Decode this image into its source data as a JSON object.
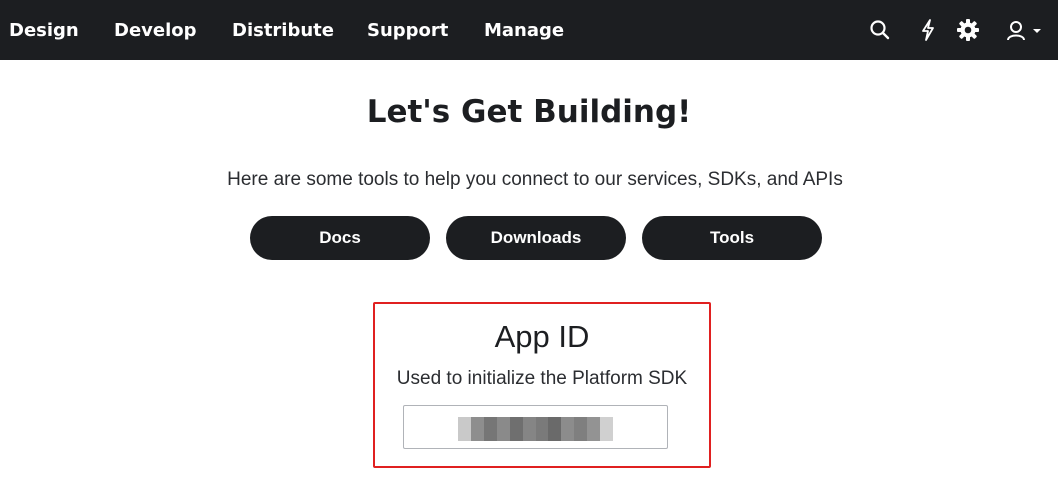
{
  "nav": {
    "items": [
      {
        "label": "Design"
      },
      {
        "label": "Develop"
      },
      {
        "label": "Distribute"
      },
      {
        "label": "Support"
      },
      {
        "label": "Manage"
      }
    ],
    "icons": [
      "search-icon",
      "bolt-icon",
      "gear-icon",
      "user-icon",
      "chevron-down-icon"
    ]
  },
  "hero": {
    "title": "Let's Get Building!",
    "subtitle": "Here are some tools to help you connect to our services, SDKs, and APIs"
  },
  "buttons": [
    {
      "label": "Docs"
    },
    {
      "label": "Downloads"
    },
    {
      "label": "Tools"
    }
  ],
  "app_id": {
    "title": "App ID",
    "description": "Used to initialize the Platform SDK",
    "value_obscured": true
  },
  "colors": {
    "nav_bg": "#1c1e21",
    "button_bg": "#1c1e21",
    "highlight_border": "#e02020"
  }
}
